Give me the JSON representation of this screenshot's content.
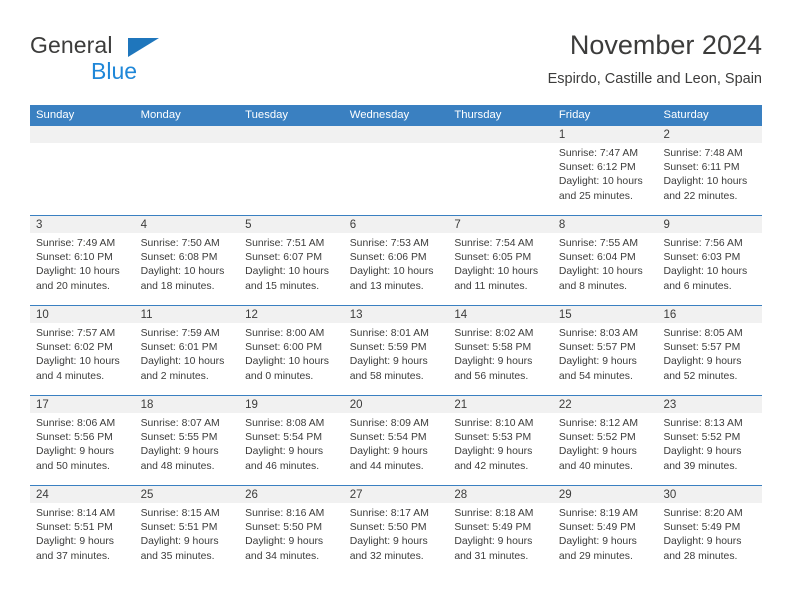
{
  "brand": {
    "name_line1": "General",
    "name_line2": "Blue",
    "triangle_color": "#1f76bc",
    "blue_text_color": "#1f87d8"
  },
  "header": {
    "title": "November 2024",
    "subtitle": "Espirdo, Castille and Leon, Spain"
  },
  "theme": {
    "header_blue": "#3a80c1",
    "daynum_bg": "#f1f1f1",
    "text": "#3c3c3b"
  },
  "weekdays": [
    "Sunday",
    "Monday",
    "Tuesday",
    "Wednesday",
    "Thursday",
    "Friday",
    "Saturday"
  ],
  "weeks": [
    [
      {
        "day": "",
        "sunrise": "",
        "sunset": "",
        "daylight": ""
      },
      {
        "day": "",
        "sunrise": "",
        "sunset": "",
        "daylight": ""
      },
      {
        "day": "",
        "sunrise": "",
        "sunset": "",
        "daylight": ""
      },
      {
        "day": "",
        "sunrise": "",
        "sunset": "",
        "daylight": ""
      },
      {
        "day": "",
        "sunrise": "",
        "sunset": "",
        "daylight": ""
      },
      {
        "day": "1",
        "sunrise": "Sunrise: 7:47 AM",
        "sunset": "Sunset: 6:12 PM",
        "daylight": "Daylight: 10 hours and 25 minutes."
      },
      {
        "day": "2",
        "sunrise": "Sunrise: 7:48 AM",
        "sunset": "Sunset: 6:11 PM",
        "daylight": "Daylight: 10 hours and 22 minutes."
      }
    ],
    [
      {
        "day": "3",
        "sunrise": "Sunrise: 7:49 AM",
        "sunset": "Sunset: 6:10 PM",
        "daylight": "Daylight: 10 hours and 20 minutes."
      },
      {
        "day": "4",
        "sunrise": "Sunrise: 7:50 AM",
        "sunset": "Sunset: 6:08 PM",
        "daylight": "Daylight: 10 hours and 18 minutes."
      },
      {
        "day": "5",
        "sunrise": "Sunrise: 7:51 AM",
        "sunset": "Sunset: 6:07 PM",
        "daylight": "Daylight: 10 hours and 15 minutes."
      },
      {
        "day": "6",
        "sunrise": "Sunrise: 7:53 AM",
        "sunset": "Sunset: 6:06 PM",
        "daylight": "Daylight: 10 hours and 13 minutes."
      },
      {
        "day": "7",
        "sunrise": "Sunrise: 7:54 AM",
        "sunset": "Sunset: 6:05 PM",
        "daylight": "Daylight: 10 hours and 11 minutes."
      },
      {
        "day": "8",
        "sunrise": "Sunrise: 7:55 AM",
        "sunset": "Sunset: 6:04 PM",
        "daylight": "Daylight: 10 hours and 8 minutes."
      },
      {
        "day": "9",
        "sunrise": "Sunrise: 7:56 AM",
        "sunset": "Sunset: 6:03 PM",
        "daylight": "Daylight: 10 hours and 6 minutes."
      }
    ],
    [
      {
        "day": "10",
        "sunrise": "Sunrise: 7:57 AM",
        "sunset": "Sunset: 6:02 PM",
        "daylight": "Daylight: 10 hours and 4 minutes."
      },
      {
        "day": "11",
        "sunrise": "Sunrise: 7:59 AM",
        "sunset": "Sunset: 6:01 PM",
        "daylight": "Daylight: 10 hours and 2 minutes."
      },
      {
        "day": "12",
        "sunrise": "Sunrise: 8:00 AM",
        "sunset": "Sunset: 6:00 PM",
        "daylight": "Daylight: 10 hours and 0 minutes."
      },
      {
        "day": "13",
        "sunrise": "Sunrise: 8:01 AM",
        "sunset": "Sunset: 5:59 PM",
        "daylight": "Daylight: 9 hours and 58 minutes."
      },
      {
        "day": "14",
        "sunrise": "Sunrise: 8:02 AM",
        "sunset": "Sunset: 5:58 PM",
        "daylight": "Daylight: 9 hours and 56 minutes."
      },
      {
        "day": "15",
        "sunrise": "Sunrise: 8:03 AM",
        "sunset": "Sunset: 5:57 PM",
        "daylight": "Daylight: 9 hours and 54 minutes."
      },
      {
        "day": "16",
        "sunrise": "Sunrise: 8:05 AM",
        "sunset": "Sunset: 5:57 PM",
        "daylight": "Daylight: 9 hours and 52 minutes."
      }
    ],
    [
      {
        "day": "17",
        "sunrise": "Sunrise: 8:06 AM",
        "sunset": "Sunset: 5:56 PM",
        "daylight": "Daylight: 9 hours and 50 minutes."
      },
      {
        "day": "18",
        "sunrise": "Sunrise: 8:07 AM",
        "sunset": "Sunset: 5:55 PM",
        "daylight": "Daylight: 9 hours and 48 minutes."
      },
      {
        "day": "19",
        "sunrise": "Sunrise: 8:08 AM",
        "sunset": "Sunset: 5:54 PM",
        "daylight": "Daylight: 9 hours and 46 minutes."
      },
      {
        "day": "20",
        "sunrise": "Sunrise: 8:09 AM",
        "sunset": "Sunset: 5:54 PM",
        "daylight": "Daylight: 9 hours and 44 minutes."
      },
      {
        "day": "21",
        "sunrise": "Sunrise: 8:10 AM",
        "sunset": "Sunset: 5:53 PM",
        "daylight": "Daylight: 9 hours and 42 minutes."
      },
      {
        "day": "22",
        "sunrise": "Sunrise: 8:12 AM",
        "sunset": "Sunset: 5:52 PM",
        "daylight": "Daylight: 9 hours and 40 minutes."
      },
      {
        "day": "23",
        "sunrise": "Sunrise: 8:13 AM",
        "sunset": "Sunset: 5:52 PM",
        "daylight": "Daylight: 9 hours and 39 minutes."
      }
    ],
    [
      {
        "day": "24",
        "sunrise": "Sunrise: 8:14 AM",
        "sunset": "Sunset: 5:51 PM",
        "daylight": "Daylight: 9 hours and 37 minutes."
      },
      {
        "day": "25",
        "sunrise": "Sunrise: 8:15 AM",
        "sunset": "Sunset: 5:51 PM",
        "daylight": "Daylight: 9 hours and 35 minutes."
      },
      {
        "day": "26",
        "sunrise": "Sunrise: 8:16 AM",
        "sunset": "Sunset: 5:50 PM",
        "daylight": "Daylight: 9 hours and 34 minutes."
      },
      {
        "day": "27",
        "sunrise": "Sunrise: 8:17 AM",
        "sunset": "Sunset: 5:50 PM",
        "daylight": "Daylight: 9 hours and 32 minutes."
      },
      {
        "day": "28",
        "sunrise": "Sunrise: 8:18 AM",
        "sunset": "Sunset: 5:49 PM",
        "daylight": "Daylight: 9 hours and 31 minutes."
      },
      {
        "day": "29",
        "sunrise": "Sunrise: 8:19 AM",
        "sunset": "Sunset: 5:49 PM",
        "daylight": "Daylight: 9 hours and 29 minutes."
      },
      {
        "day": "30",
        "sunrise": "Sunrise: 8:20 AM",
        "sunset": "Sunset: 5:49 PM",
        "daylight": "Daylight: 9 hours and 28 minutes."
      }
    ]
  ]
}
